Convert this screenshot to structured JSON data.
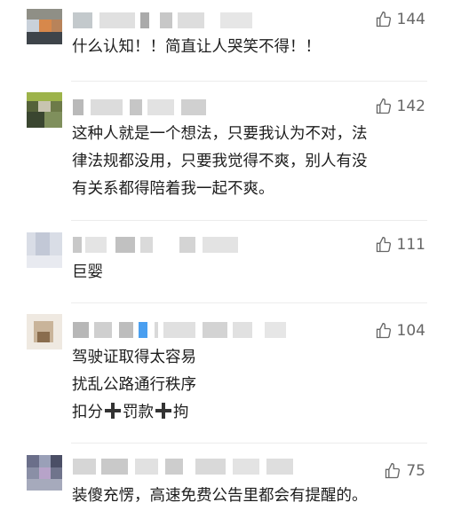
{
  "comments": [
    {
      "likes": "144",
      "lines": [
        "什么认知！！简直让人哭笑不得！！"
      ]
    },
    {
      "likes": "142",
      "lines": [
        "这种人就是一个想法，只要我认为不对，法",
        "律法规都没用，只要我觉得不爽，别人有没",
        "有关系都得陪着我一起不爽。"
      ]
    },
    {
      "likes": "111",
      "lines": [
        "巨婴"
      ]
    },
    {
      "likes": "104",
      "lines": [
        "驾驶证取得太容易",
        "扰乱公路通行秩序"
      ],
      "line3_parts": [
        "扣分",
        "罚款",
        "拘"
      ]
    },
    {
      "likes": "75",
      "lines": [
        "装傻充愣，高速免费公告里都会有提醒的。"
      ]
    }
  ],
  "icons": {
    "like": "thumbs-up-icon",
    "plus": "plus-emoji-icon"
  },
  "colors": {
    "text": "#1d1d1d",
    "meta": "#666666"
  }
}
